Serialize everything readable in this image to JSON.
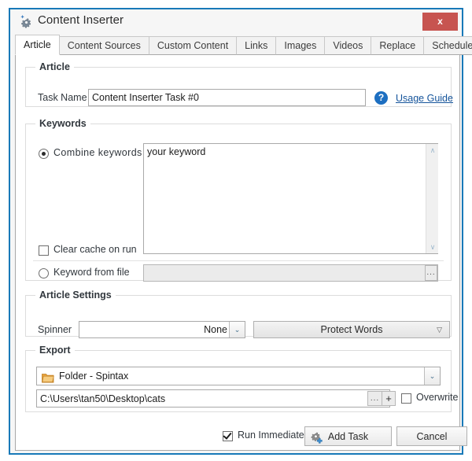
{
  "window": {
    "title": "Content Inserter",
    "title_icon": "gear-sparkle-icon",
    "close_label": "x",
    "border_color": "#1879b8",
    "close_color": "#c75450"
  },
  "tabs": [
    {
      "label": "Article",
      "active": true
    },
    {
      "label": "Content Sources",
      "active": false
    },
    {
      "label": "Custom Content",
      "active": false
    },
    {
      "label": "Links",
      "active": false
    },
    {
      "label": "Images",
      "active": false
    },
    {
      "label": "Videos",
      "active": false
    },
    {
      "label": "Replace",
      "active": false
    },
    {
      "label": "Schedule",
      "active": false
    }
  ],
  "article_group": {
    "label": "Article",
    "task_name_label": "Task Name",
    "task_name_value": "Content Inserter Task #0",
    "help_icon": "question-mark-icon",
    "help_glyph": "?",
    "usage_guide_link": "Usage Guide"
  },
  "keywords_group": {
    "label": "Keywords",
    "combine_radio_label": "Combine keywords",
    "combine_radio_selected": true,
    "keywords_text": "your keyword",
    "clear_cache_label": "Clear cache on run",
    "clear_cache_checked": false,
    "keyword_from_file_label": "Keyword from file",
    "keyword_from_file_selected": false,
    "keyword_file_value": "",
    "browse_label": "...",
    "scroll_up_glyph": "∧",
    "scroll_down_glyph": "∨"
  },
  "article_settings_group": {
    "label": "Article Settings",
    "spinner_label": "Spinner",
    "spinner_value": "None",
    "spinner_arrow": "⌄",
    "protect_words_label": "Protect Words",
    "protect_words_arrow": "▽"
  },
  "export_group": {
    "label": "Export",
    "format_icon": "folder-icon",
    "format_value": "Folder - Spintax",
    "format_arrow": "⌄",
    "path_value": "C:\\Users\\tan50\\Desktop\\cats",
    "browse_label": "...",
    "add_label": "+",
    "overwrite_label": "Overwrite",
    "overwrite_checked": false
  },
  "footer": {
    "run_immediately_label": "Run Immediately",
    "run_immediately_checked": true,
    "add_task_label": "Add Task",
    "add_task_icon": "gear-plus-icon",
    "cancel_label": "Cancel"
  }
}
